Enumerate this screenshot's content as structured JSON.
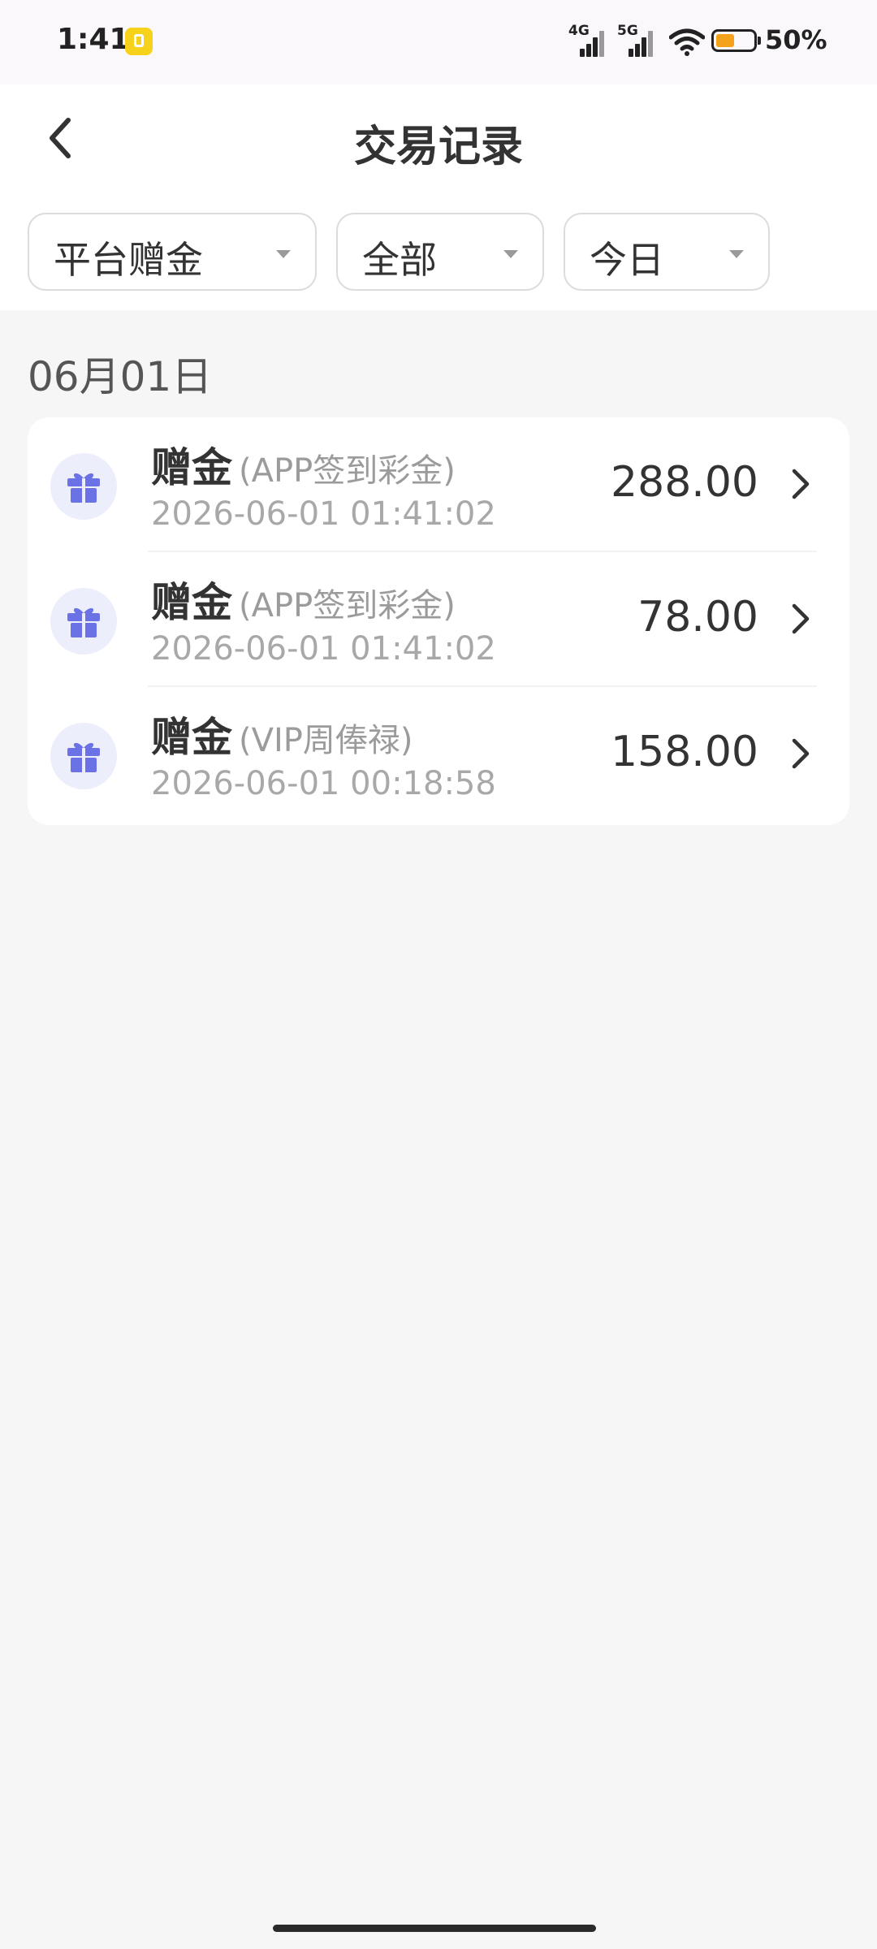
{
  "status_bar": {
    "time": "1:41",
    "network_1": "4G",
    "network_2": "5G",
    "battery_percent": 50,
    "battery_text": "50%"
  },
  "header": {
    "title": "交易记录"
  },
  "filters": [
    {
      "label": "平台赠金"
    },
    {
      "label": "全部"
    },
    {
      "label": "今日"
    }
  ],
  "date_group": "06月01日",
  "records": [
    {
      "type": "赠金",
      "subtype": "(APP签到彩金)",
      "time": "2026-06-01 01:41:02",
      "amount": "288.00"
    },
    {
      "type": "赠金",
      "subtype": "(APP签到彩金)",
      "time": "2026-06-01 01:41:02",
      "amount": "78.00"
    },
    {
      "type": "赠金",
      "subtype": "(VIP周俸禄)",
      "time": "2026-06-01 00:18:58",
      "amount": "158.00"
    }
  ],
  "colors": {
    "icon_accent": "#6a72e6",
    "battery_fill": "#f4a21c",
    "app_badge": "#f7d21a"
  }
}
